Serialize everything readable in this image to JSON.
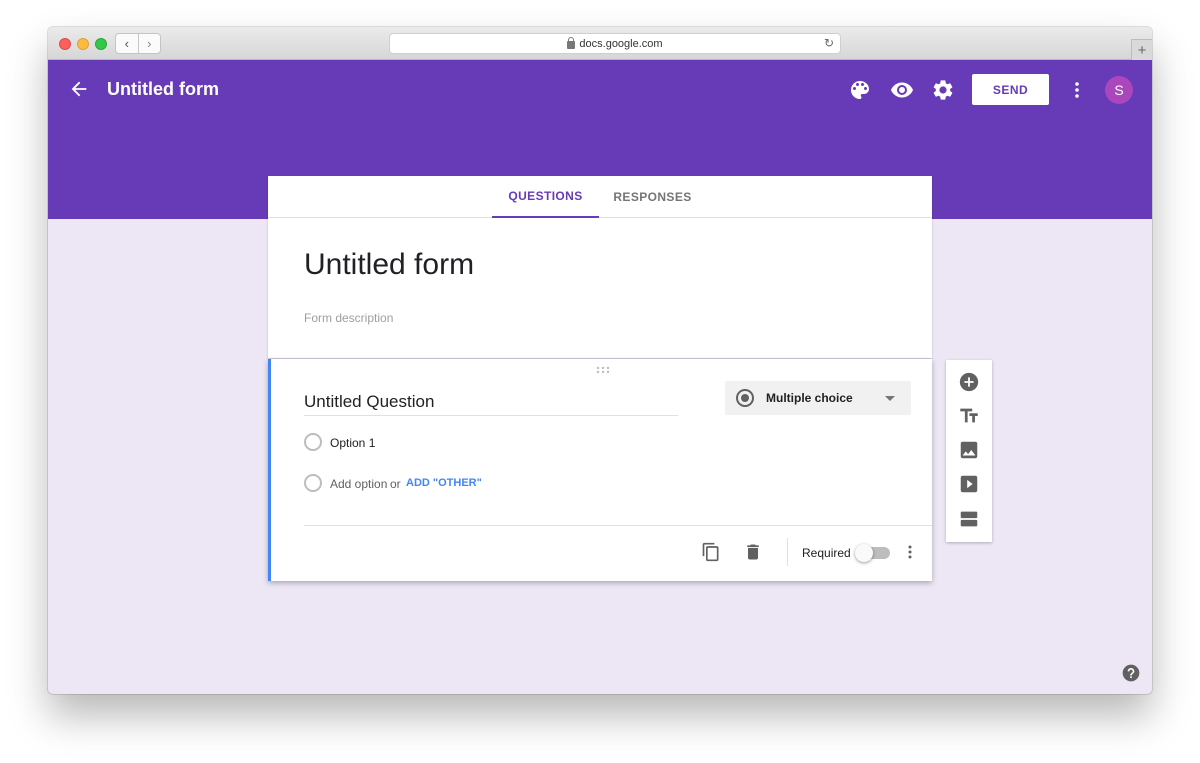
{
  "browser": {
    "url": "docs.google.com",
    "reload_glyph": "↻",
    "new_tab_glyph": "+",
    "back_glyph": "‹",
    "forward_glyph": "›"
  },
  "appbar": {
    "title": "Untitled form",
    "send_label": "SEND",
    "avatar_initial": "S",
    "icons": [
      "arrow-back-icon",
      "palette-icon",
      "eye-icon",
      "gear-icon",
      "more-vert-icon"
    ]
  },
  "tabs": [
    {
      "label": "QUESTIONS",
      "active": true
    },
    {
      "label": "RESPONSES",
      "active": false
    }
  ],
  "form": {
    "title": "Untitled form",
    "description_placeholder": "Form description"
  },
  "question": {
    "title": "Untitled Question",
    "type": "Multiple choice",
    "options": [
      "Option 1"
    ],
    "add_option": "Add option",
    "or_text": "or",
    "add_other": "ADD \"OTHER\"",
    "required_label": "Required",
    "required": false
  },
  "toolbar": {
    "items": [
      "add-question-icon",
      "title-text-icon",
      "image-icon",
      "video-icon",
      "section-icon"
    ]
  },
  "colors": {
    "accent": "#673ab7",
    "background": "#ece6f5",
    "link": "#4285f4"
  }
}
